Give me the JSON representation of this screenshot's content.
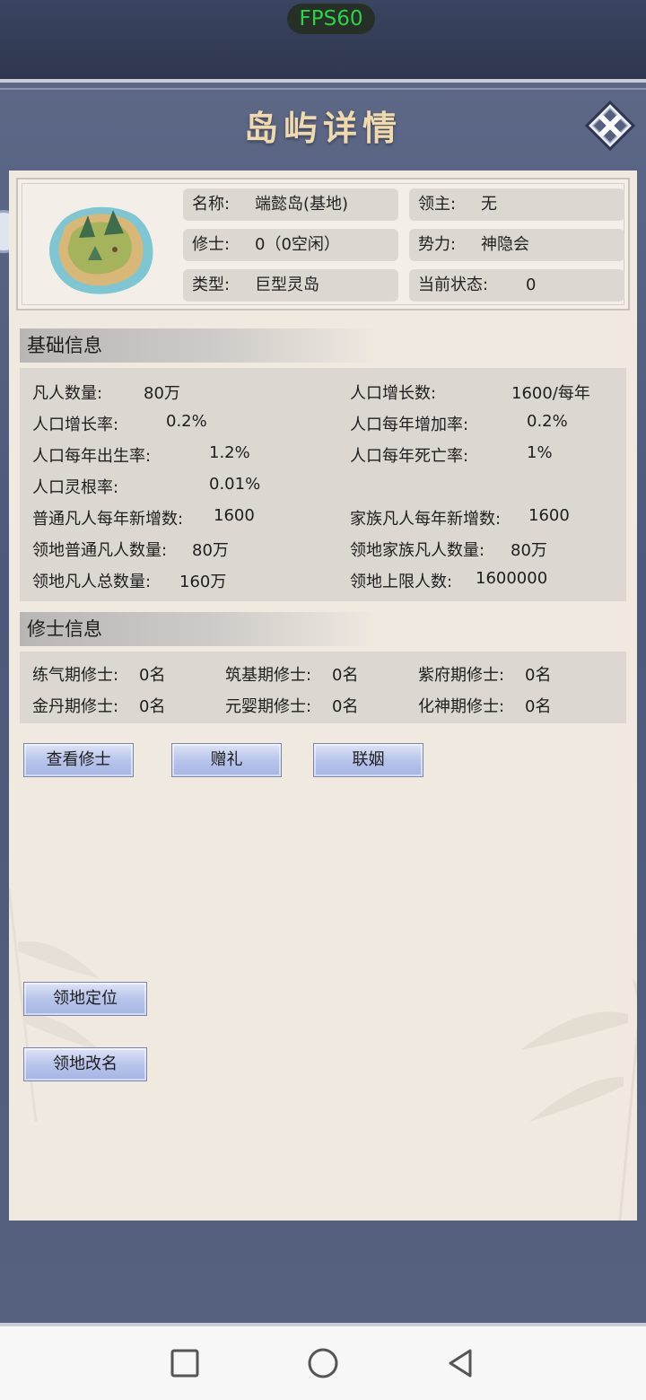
{
  "fps": "FPS60",
  "title": "岛屿详情",
  "info": {
    "name_label": "名称:",
    "name_value": "端懿岛(基地)",
    "lord_label": "领主:",
    "lord_value": "无",
    "cultivator_label": "修士:",
    "cultivator_value": "0（0空闲）",
    "faction_label": "势力:",
    "faction_value": "神隐会",
    "type_label": "类型:",
    "type_value": "巨型灵岛",
    "status_label": "当前状态:",
    "status_value": "0"
  },
  "basic": {
    "header": "基础信息",
    "rows": [
      {
        "label": "凡人数量:",
        "value": "80万"
      },
      {
        "label": "人口增长数:",
        "value": "1600/每年"
      },
      {
        "label": "人口增长率:",
        "value": "0.2%"
      },
      {
        "label": "人口每年增加率:",
        "value": "0.2%"
      },
      {
        "label": "人口每年出生率:",
        "value": "1.2%"
      },
      {
        "label": "人口每年死亡率:",
        "value": "1%"
      },
      {
        "label": "人口灵根率:",
        "value": "0.01%"
      },
      {
        "label": "普通凡人每年新增数:",
        "value": "1600"
      },
      {
        "label": "家族凡人每年新增数:",
        "value": "1600"
      },
      {
        "label": "领地普通凡人数量:",
        "value": "80万"
      },
      {
        "label": "领地家族凡人数量:",
        "value": "80万"
      },
      {
        "label": "领地凡人总数量:",
        "value": "160万"
      },
      {
        "label": "领地上限人数:",
        "value": "1600000"
      }
    ]
  },
  "cultivators": {
    "header": "修士信息",
    "items": [
      {
        "label": "练气期修士:",
        "value": "0名"
      },
      {
        "label": "筑基期修士:",
        "value": "0名"
      },
      {
        "label": "紫府期修士:",
        "value": "0名"
      },
      {
        "label": "金丹期修士:",
        "value": "0名"
      },
      {
        "label": "元婴期修士:",
        "value": "0名"
      },
      {
        "label": "化神期修士:",
        "value": "0名"
      }
    ]
  },
  "buttons": {
    "view": "查看修士",
    "gift": "赠礼",
    "marriage": "联姻",
    "locate": "领地定位",
    "rename": "领地改名"
  },
  "icons": {
    "close": "close-icon",
    "island": "island-icon",
    "nav_recent": "square-icon",
    "nav_home": "circle-icon",
    "nav_back": "triangle-back-icon"
  }
}
